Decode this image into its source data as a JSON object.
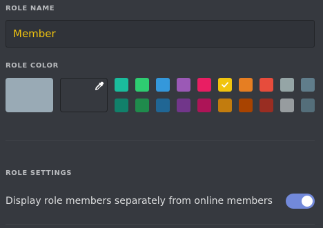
{
  "role_name": {
    "title": "ROLE NAME",
    "value": "Member",
    "value_color": "#f1c40f"
  },
  "role_color": {
    "title": "ROLE COLOR",
    "default_color": "#99aab5",
    "custom_icon": "eyedropper-icon",
    "selected_index": 5,
    "swatches_top": [
      "#1abc9c",
      "#2ecc71",
      "#3498db",
      "#9b59b6",
      "#e91e63",
      "#f1c40f",
      "#e67e22",
      "#e74c3c",
      "#95a5a6",
      "#607d8b"
    ],
    "swatches_bottom": [
      "#11806a",
      "#1f8b4c",
      "#206694",
      "#71368a",
      "#ad1457",
      "#c27c0e",
      "#a84300",
      "#992d22",
      "#979c9f",
      "#546e7a"
    ]
  },
  "role_settings": {
    "title": "ROLE SETTINGS",
    "hoist_label": "Display role members separately from online members",
    "hoist_enabled": true,
    "toggle_color": "#7289da"
  }
}
